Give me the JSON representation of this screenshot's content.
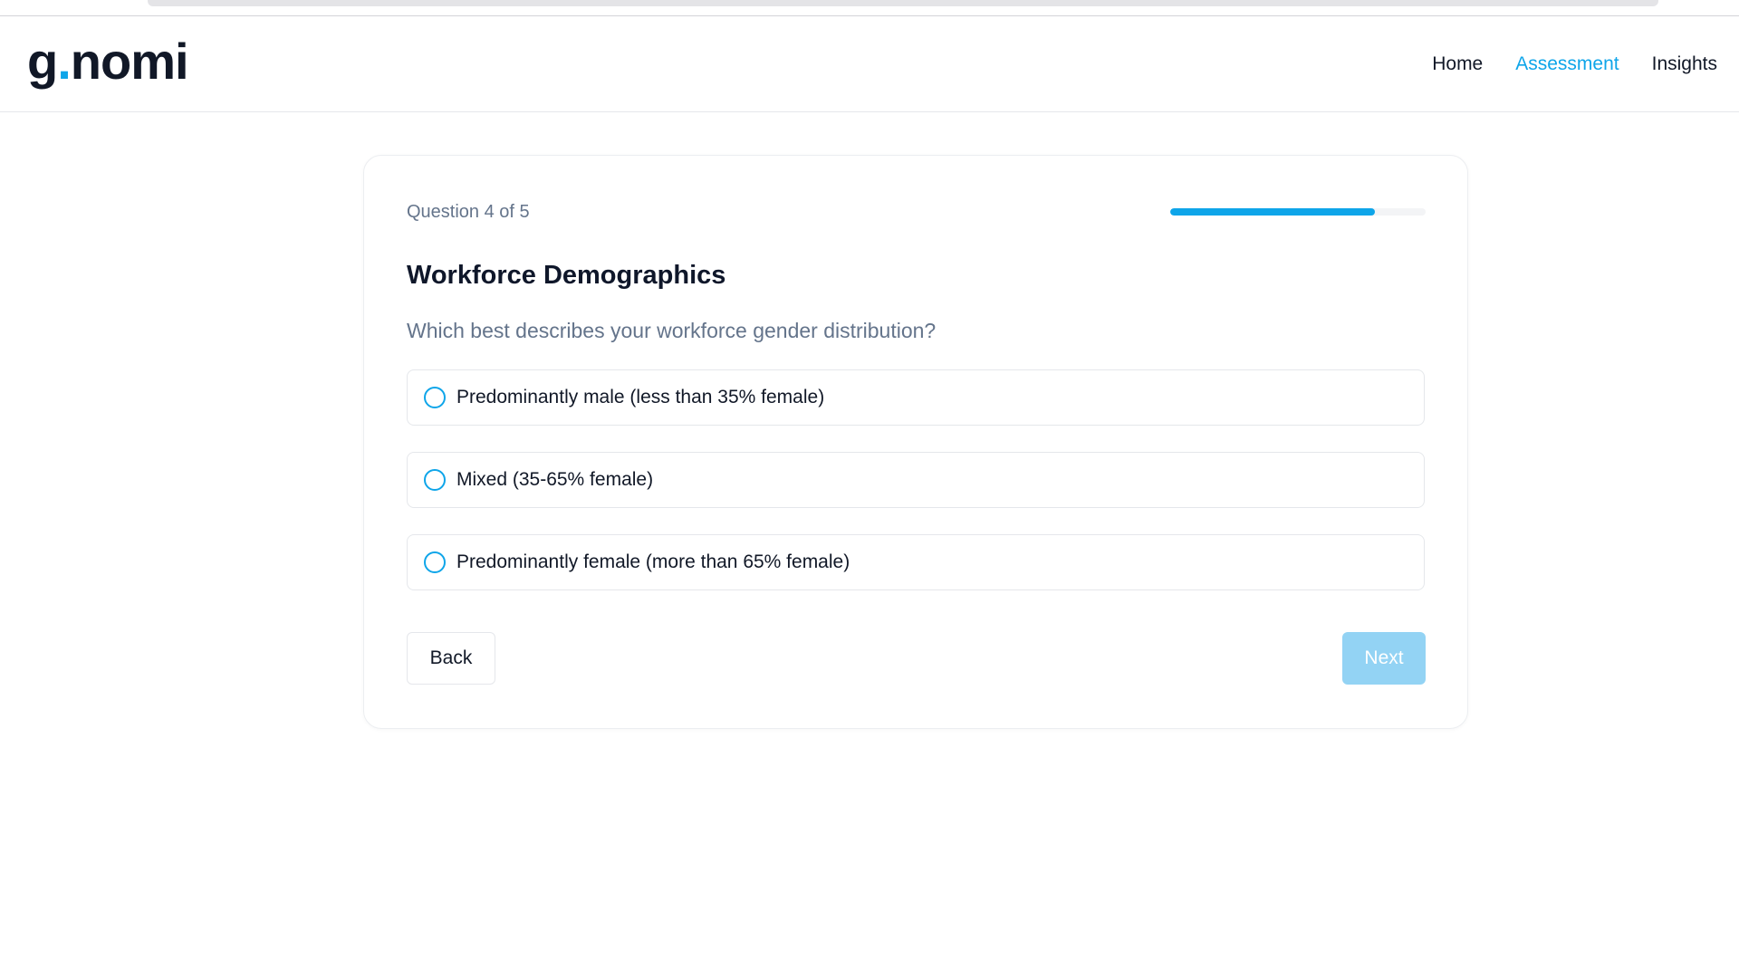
{
  "nav": {
    "logo_left": "g",
    "logo_dot": ".",
    "logo_right": "nomi",
    "links": [
      {
        "label": "Home",
        "active": false
      },
      {
        "label": "Assessment",
        "active": true
      },
      {
        "label": "Insights",
        "active": false
      }
    ]
  },
  "assessment": {
    "counter": "Question 4 of 5",
    "progress": 0.8,
    "section_title": "Workforce Demographics",
    "question": "Which best describes your workforce gender distribution?",
    "options": [
      {
        "label": "Predominantly male (less than 35% female)",
        "selected": false
      },
      {
        "label": "Mixed (35-65% female)",
        "selected": false
      },
      {
        "label": "Predominantly female (more than 65% female)",
        "selected": false
      }
    ],
    "back_label": "Back",
    "next_label": "Next",
    "next_disabled": true
  },
  "colors": {
    "accent": "#0ea5e9",
    "next_disabled_bg": "#93d3f4",
    "muted_text": "#64748b"
  },
  "icons": {
    "radio": "radio-unchecked-icon"
  }
}
